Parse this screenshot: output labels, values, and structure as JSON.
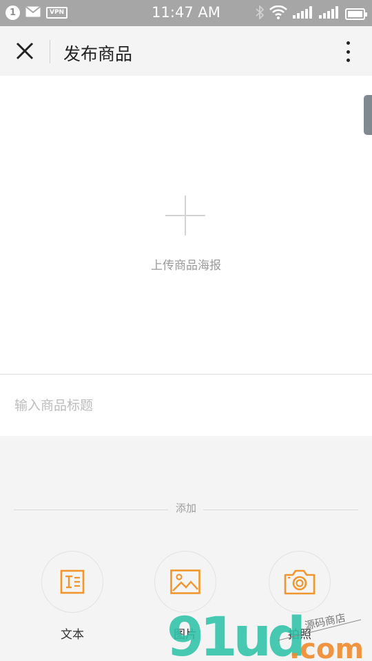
{
  "status_bar": {
    "notification_count": "1",
    "vpn_label": "VPN",
    "time": "11:47 AM"
  },
  "header": {
    "title": "发布商品",
    "close_icon": "close-icon",
    "more_icon": "more-vertical-icon"
  },
  "upload": {
    "label": "上传商品海报",
    "icon": "plus-icon"
  },
  "title_input": {
    "placeholder": "输入商品标题",
    "value": ""
  },
  "add_section": {
    "label": "添加",
    "tools": [
      {
        "label": "文本",
        "icon": "text-icon"
      },
      {
        "label": "图片",
        "icon": "image-icon"
      },
      {
        "label": "拍照",
        "icon": "camera-icon"
      }
    ]
  },
  "watermark": {
    "brand": "91ud",
    "domain": ".com",
    "tagline": "源码商店"
  },
  "colors": {
    "accent": "#f0962c",
    "status_bar": "#a6a6a6",
    "background": "#f4f4f4"
  }
}
